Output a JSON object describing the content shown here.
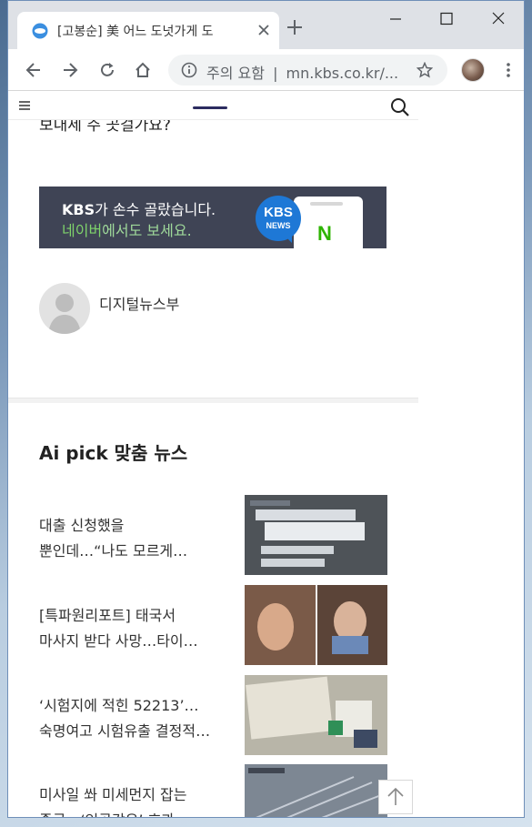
{
  "browser": {
    "tab_title": "[고봉순] 美 어느 도넛가게 도",
    "omnibox": {
      "security_label": "주의 요함",
      "separator": "|",
      "url": "mn.kbs.co.kr/..."
    },
    "icons": {
      "back": "back-arrow-icon",
      "forward": "forward-arrow-icon",
      "reload": "reload-icon",
      "home": "home-icon",
      "info": "info-icon",
      "bookmark": "star-icon",
      "menu": "more-vertical-icon"
    }
  },
  "page": {
    "cut_off_text": "보내세 주 곳걸가요?",
    "banner": {
      "brand": "KBS",
      "line1_rest": "가 손수 골랐습니다.",
      "line2_highlight": "네이버",
      "line2_rest": "에서도 보세요.",
      "bubble_top": "KBS",
      "bubble_bottom": "NEWS",
      "naver_logo": "N"
    },
    "reporter": {
      "name": "디지털뉴스부"
    },
    "section_title": "Ai pick 맞춤 뉴스",
    "news": [
      {
        "line1": "대출 신청했을",
        "line2": "뿐인데…“나도 모르게…"
      },
      {
        "line1": "[특파원리포트] 태국서",
        "line2": "마사지 받다 사망…타이…"
      },
      {
        "line1": "‘시험지에 적힌 52213’…",
        "line2": "숙명여고 시험유출 결정적…"
      },
      {
        "line1": "미사일 쏴 미세먼지 잡는",
        "line2": "중국…‘인공강우’ 효과…"
      }
    ],
    "colors": {
      "banner_bg": "#3f4455",
      "naver_green": "#2db400",
      "kbs_blue": "#1e78d6",
      "header_accent": "#2c2c60"
    }
  }
}
